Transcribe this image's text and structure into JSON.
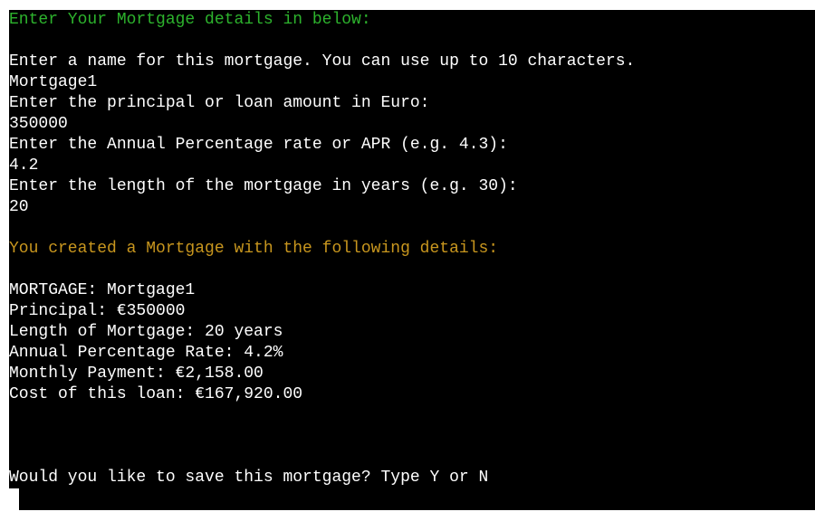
{
  "terminal": {
    "header": "Enter Your Mortgage details in below:",
    "prompt_name": "Enter a name for this mortgage. You can use up to 10 characters.",
    "input_name": "Mortgage1",
    "prompt_principal": "Enter the principal or loan amount in Euro:",
    "input_principal": "350000",
    "prompt_apr": "Enter the Annual Percentage rate or APR (e.g. 4.3):",
    "input_apr": "4.2",
    "prompt_length": "Enter the length of the mortgage in years (e.g. 30):",
    "input_length": "20",
    "created_heading": "You created a Mortgage with the following details:",
    "summary": {
      "mortgage": "MORTGAGE: Mortgage1",
      "principal": "Principal: €350000",
      "length": "Length of Mortgage: 20 years",
      "apr": "Annual Percentage Rate: 4.2%",
      "monthly": "Monthly Payment: €2,158.00",
      "cost": "Cost of this loan: €167,920.00"
    },
    "save_prompt": "Would you like to save this mortgage? Type Y or N"
  },
  "colors": {
    "background": "#000000",
    "text": "#ffffff",
    "header_green": "#2db32d",
    "heading_gold": "#c8961e"
  }
}
